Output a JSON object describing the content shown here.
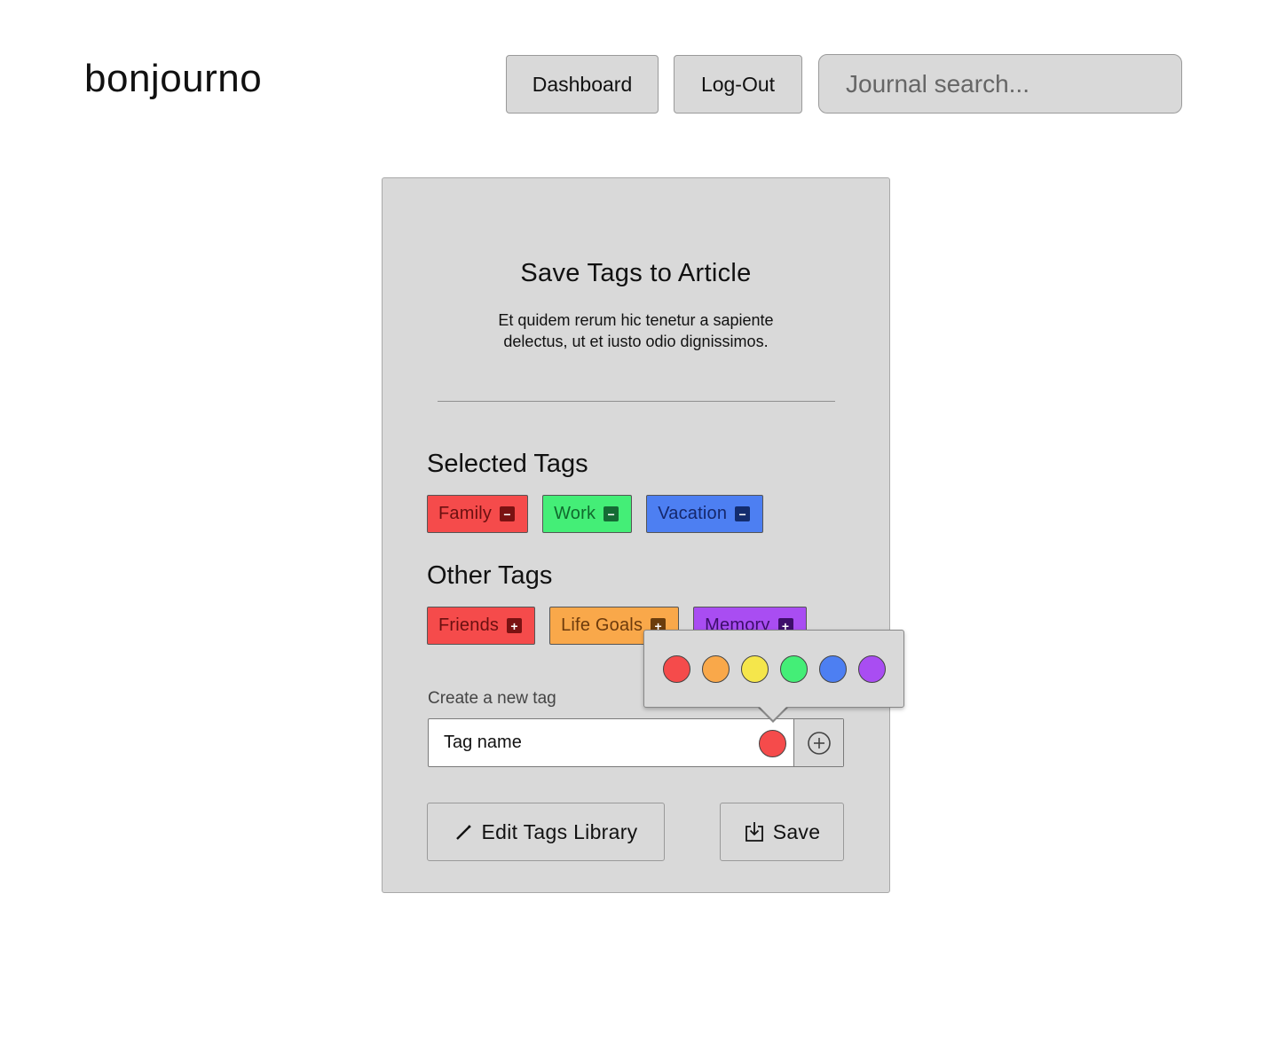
{
  "header": {
    "logo": "bonjourno",
    "dashboard_label": "Dashboard",
    "logout_label": "Log-Out",
    "search_placeholder": "Journal search..."
  },
  "card": {
    "title": "Save Tags to Article",
    "description": "Et quidem rerum hic tenetur a sapiente delectus, ut et iusto odio dignissimos.",
    "selected_title": "Selected Tags",
    "selected_tags": [
      {
        "label": "Family",
        "color": "#f54b4b"
      },
      {
        "label": "Work",
        "color": "#44ee77"
      },
      {
        "label": "Vacation",
        "color": "#4d7ff2"
      }
    ],
    "other_title": "Other Tags",
    "other_tags": [
      {
        "label": "Friends",
        "color": "#f54b4b"
      },
      {
        "label": "Life Goals",
        "color": "#f9a84a"
      },
      {
        "label": "Memory",
        "color": "#a94df2"
      }
    ],
    "new_tag_label": "Create a new tag",
    "new_tag_placeholder": "Tag name",
    "new_tag_color": "#f54b4b",
    "edit_library_label": "Edit Tags Library",
    "save_label": "Save"
  },
  "color_picker": {
    "swatches": [
      "#f54b4b",
      "#f9a84a",
      "#f5e64b",
      "#44ee77",
      "#4d7ff2",
      "#a94df2"
    ],
    "swatch_names": [
      "red-swatch",
      "orange-swatch",
      "yellow-swatch",
      "green-swatch",
      "blue-swatch",
      "purple-swatch"
    ]
  },
  "icons": {
    "remove_tag": "minus-icon",
    "add_tag": "plus-icon",
    "add_new": "plus-circle-icon",
    "edit": "pencil-icon",
    "save": "download-icon"
  }
}
